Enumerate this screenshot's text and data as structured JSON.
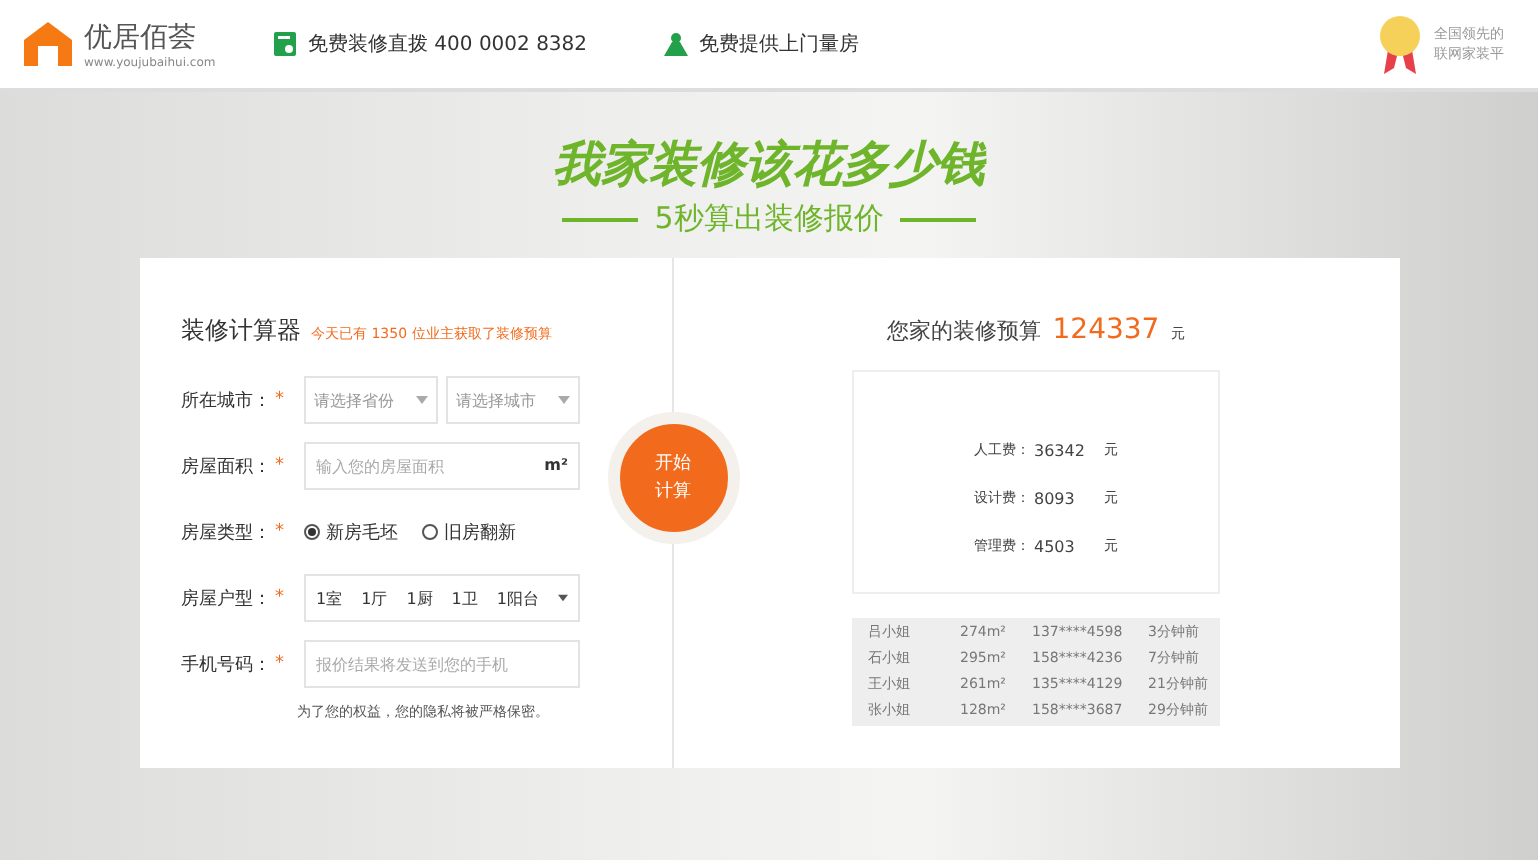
{
  "header": {
    "brand": "优居佰荟",
    "domain": "www.youjubaihui.com",
    "hotline": "免费装修直拨 400 0002 8382",
    "service": "免费提供上门量房",
    "badge_lines": [
      "全国领先的",
      "联网家装平"
    ]
  },
  "hero": {
    "title": "我家装修该花多少钱",
    "subtitle": "5秒算出装修报价"
  },
  "calculator": {
    "title": "装修计算器",
    "notice": "今天已有 1350 位业主获取了装修预算",
    "fields": [
      {
        "kind": "selects",
        "label": "所在城市：",
        "mark": "*",
        "options": [
          "请选择省份",
          "请选择城市"
        ]
      },
      {
        "kind": "input",
        "label": "房屋面积：",
        "mark": "*",
        "placeholder": "输入您的房屋面积",
        "unit": "m²"
      },
      {
        "kind": "radios",
        "label": "房屋类型：",
        "mark": "*",
        "choices": [
          {
            "label": "新房毛坯",
            "selected": true
          },
          {
            "label": "旧房翻新",
            "selected": false
          }
        ]
      },
      {
        "kind": "layout",
        "label": "房屋户型：",
        "mark": "*",
        "parts": [
          "1室",
          "1厅",
          "1厨",
          "1卫",
          "1阳台"
        ]
      },
      {
        "kind": "input",
        "label": "手机号码：",
        "mark": "*",
        "placeholder": "报价结果将发送到您的手机"
      }
    ],
    "privacy": "为了您的权益，您的隐私将被严格保密。",
    "button": "开始计算"
  },
  "result": {
    "title": "您家的装修预算",
    "total": "124337",
    "unit": "元",
    "breakdown": [
      {
        "label": "人工费：",
        "value": "36342",
        "unit": "元"
      },
      {
        "label": "设计费：",
        "value": "8093",
        "unit": "元"
      },
      {
        "label": "管理费：",
        "value": "4503",
        "unit": "元"
      }
    ],
    "recent": [
      [
        "吕小姐",
        "274m²",
        "137****4598",
        "3分钟前"
      ],
      [
        "石小姐",
        "295m²",
        "158****4236",
        "7分钟前"
      ],
      [
        "王小姐",
        "261m²",
        "135****4129",
        "21分钟前"
      ],
      [
        "张小姐",
        "128m²",
        "158****3687",
        "29分钟前"
      ]
    ]
  }
}
